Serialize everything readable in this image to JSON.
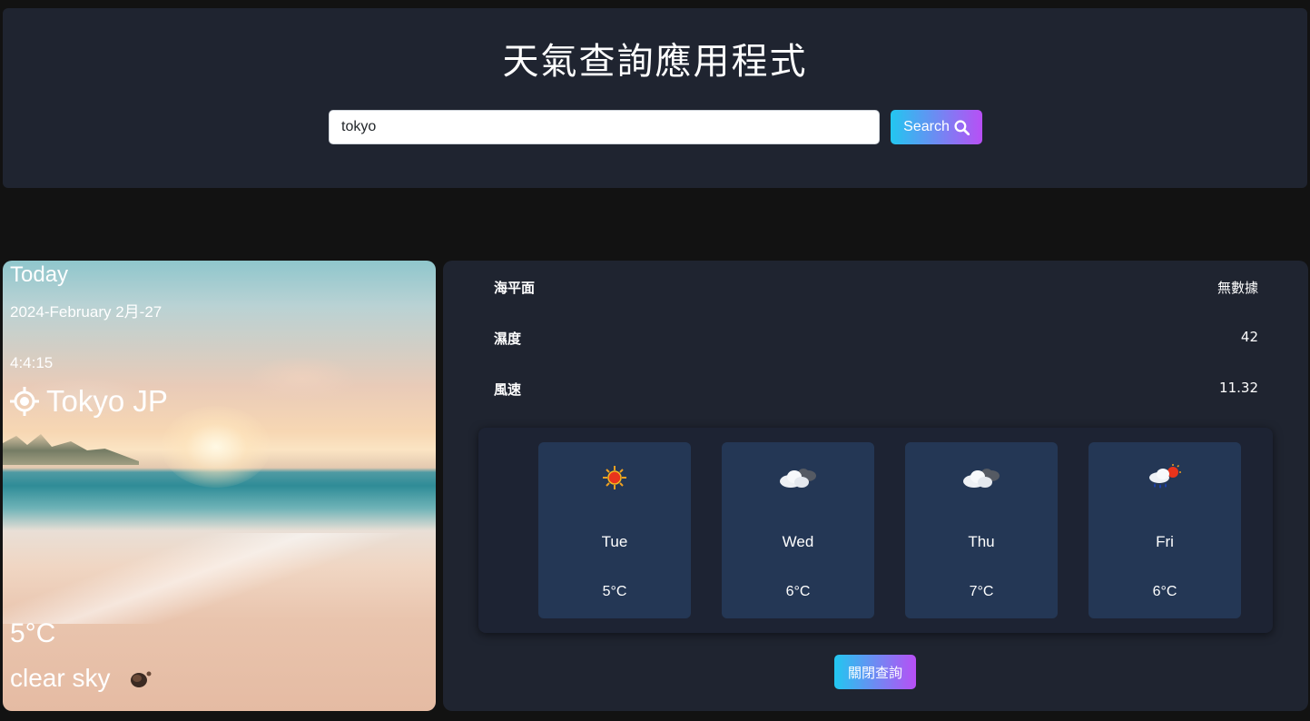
{
  "header": {
    "title": "天氣查詢應用程式",
    "search_value": "tokyo",
    "search_button_label": "Search"
  },
  "today": {
    "label": "Today",
    "date": "2024-February 2月-27",
    "time": "4:4:15",
    "location": "Tokyo JP",
    "temperature": "5°C",
    "condition": "clear sky",
    "condition_icon": "clear-sky-icon"
  },
  "details": [
    {
      "label": "海平面",
      "value": "無數據"
    },
    {
      "label": "濕度",
      "value": "42"
    },
    {
      "label": "風速",
      "value": "11.32"
    }
  ],
  "forecast": [
    {
      "day": "Tue",
      "temp": "5°C",
      "icon": "sun-icon"
    },
    {
      "day": "Wed",
      "temp": "6°C",
      "icon": "cloud-icon"
    },
    {
      "day": "Thu",
      "temp": "7°C",
      "icon": "cloud-icon"
    },
    {
      "day": "Fri",
      "temp": "6°C",
      "icon": "rain-sun-icon"
    }
  ],
  "close_button_label": "關閉查詢",
  "colors": {
    "background": "#121212",
    "panel": "#1f2430",
    "forecast_card": "#243755",
    "accent_gradient_start": "#22c7f0",
    "accent_gradient_end": "#b84ff5"
  }
}
